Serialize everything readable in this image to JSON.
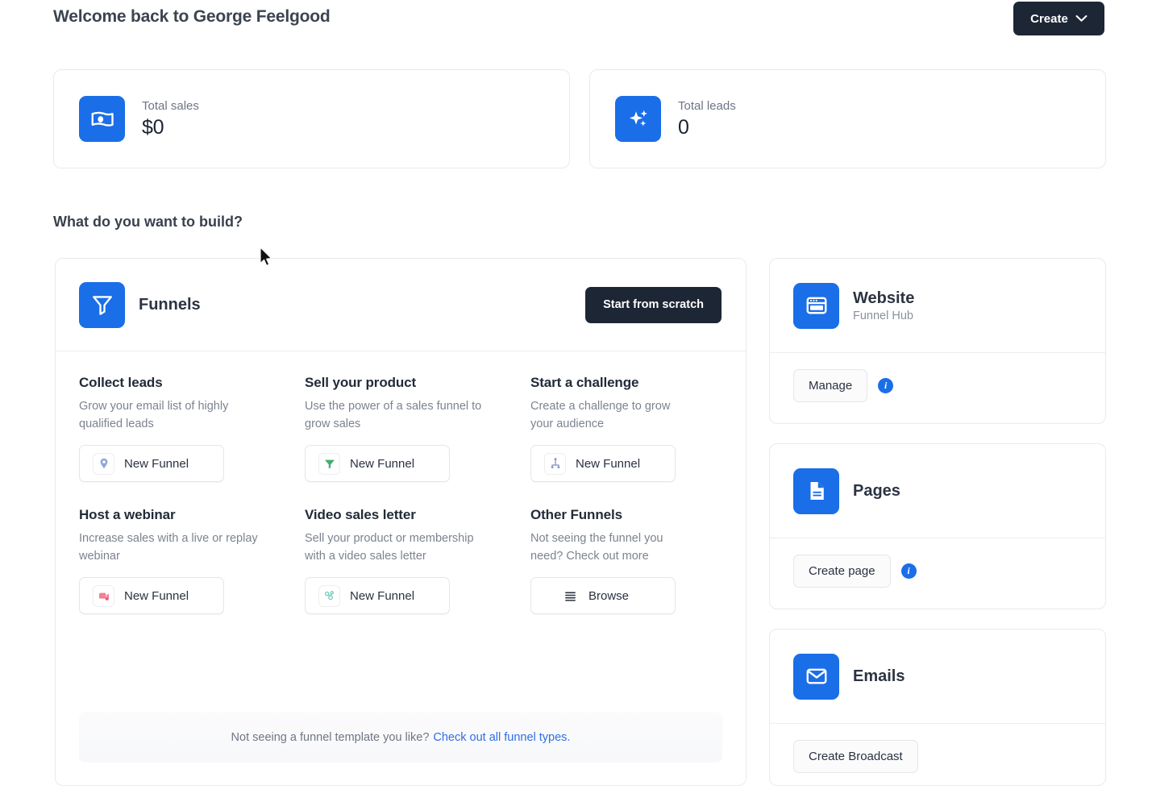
{
  "header": {
    "welcome_title": "Welcome back to George Feelgood",
    "create_button": "Create"
  },
  "stats": [
    {
      "label": "Total sales",
      "value": "$0",
      "icon": "banknote-icon"
    },
    {
      "label": "Total leads",
      "value": "0",
      "icon": "sparkles-icon"
    }
  ],
  "section": {
    "title": "What do you want to build?"
  },
  "funnels_panel": {
    "title": "Funnels",
    "icon": "funnel-icon",
    "start_from_scratch": "Start from scratch",
    "items": [
      {
        "title": "Collect leads",
        "desc": "Grow your email list of highly qualified leads",
        "button": "New Funnel",
        "icon": "lead-magnet-icon"
      },
      {
        "title": "Sell your product",
        "desc": "Use the power of a sales funnel to grow sales",
        "button": "New Funnel",
        "icon": "green-funnel-icon"
      },
      {
        "title": "Start a challenge",
        "desc": "Create a challenge to grow your audience",
        "button": "New Funnel",
        "icon": "challenge-hierarchy-icon"
      },
      {
        "title": "Host a webinar",
        "desc": "Increase sales with a live or replay webinar",
        "button": "New Funnel",
        "icon": "webinar-camera-icon"
      },
      {
        "title": "Video sales letter",
        "desc": "Sell your product or membership with a video sales letter",
        "button": "New Funnel",
        "icon": "video-network-icon"
      },
      {
        "title": "Other Funnels",
        "desc": "Not seeing the funnel you need? Check out more",
        "button": "Browse",
        "icon": "list-icon"
      }
    ],
    "banner": {
      "text": "Not seeing a funnel template you like?",
      "link": "Check out all funnel types."
    }
  },
  "side_cards": [
    {
      "title": "Website",
      "subtitle": "Funnel Hub",
      "icon": "browser-window-icon",
      "action": "Manage",
      "info": "i"
    },
    {
      "title": "Pages",
      "subtitle": "",
      "icon": "document-icon",
      "action": "Create page",
      "info": "i"
    },
    {
      "title": "Emails",
      "subtitle": "",
      "icon": "envelope-icon",
      "action": "Create Broadcast",
      "info": ""
    }
  ],
  "colors": {
    "brand_blue": "#1a6ee8",
    "dark_button": "#1d2635",
    "link_blue": "#2f6fe4",
    "card_border": "#e8eaee"
  }
}
